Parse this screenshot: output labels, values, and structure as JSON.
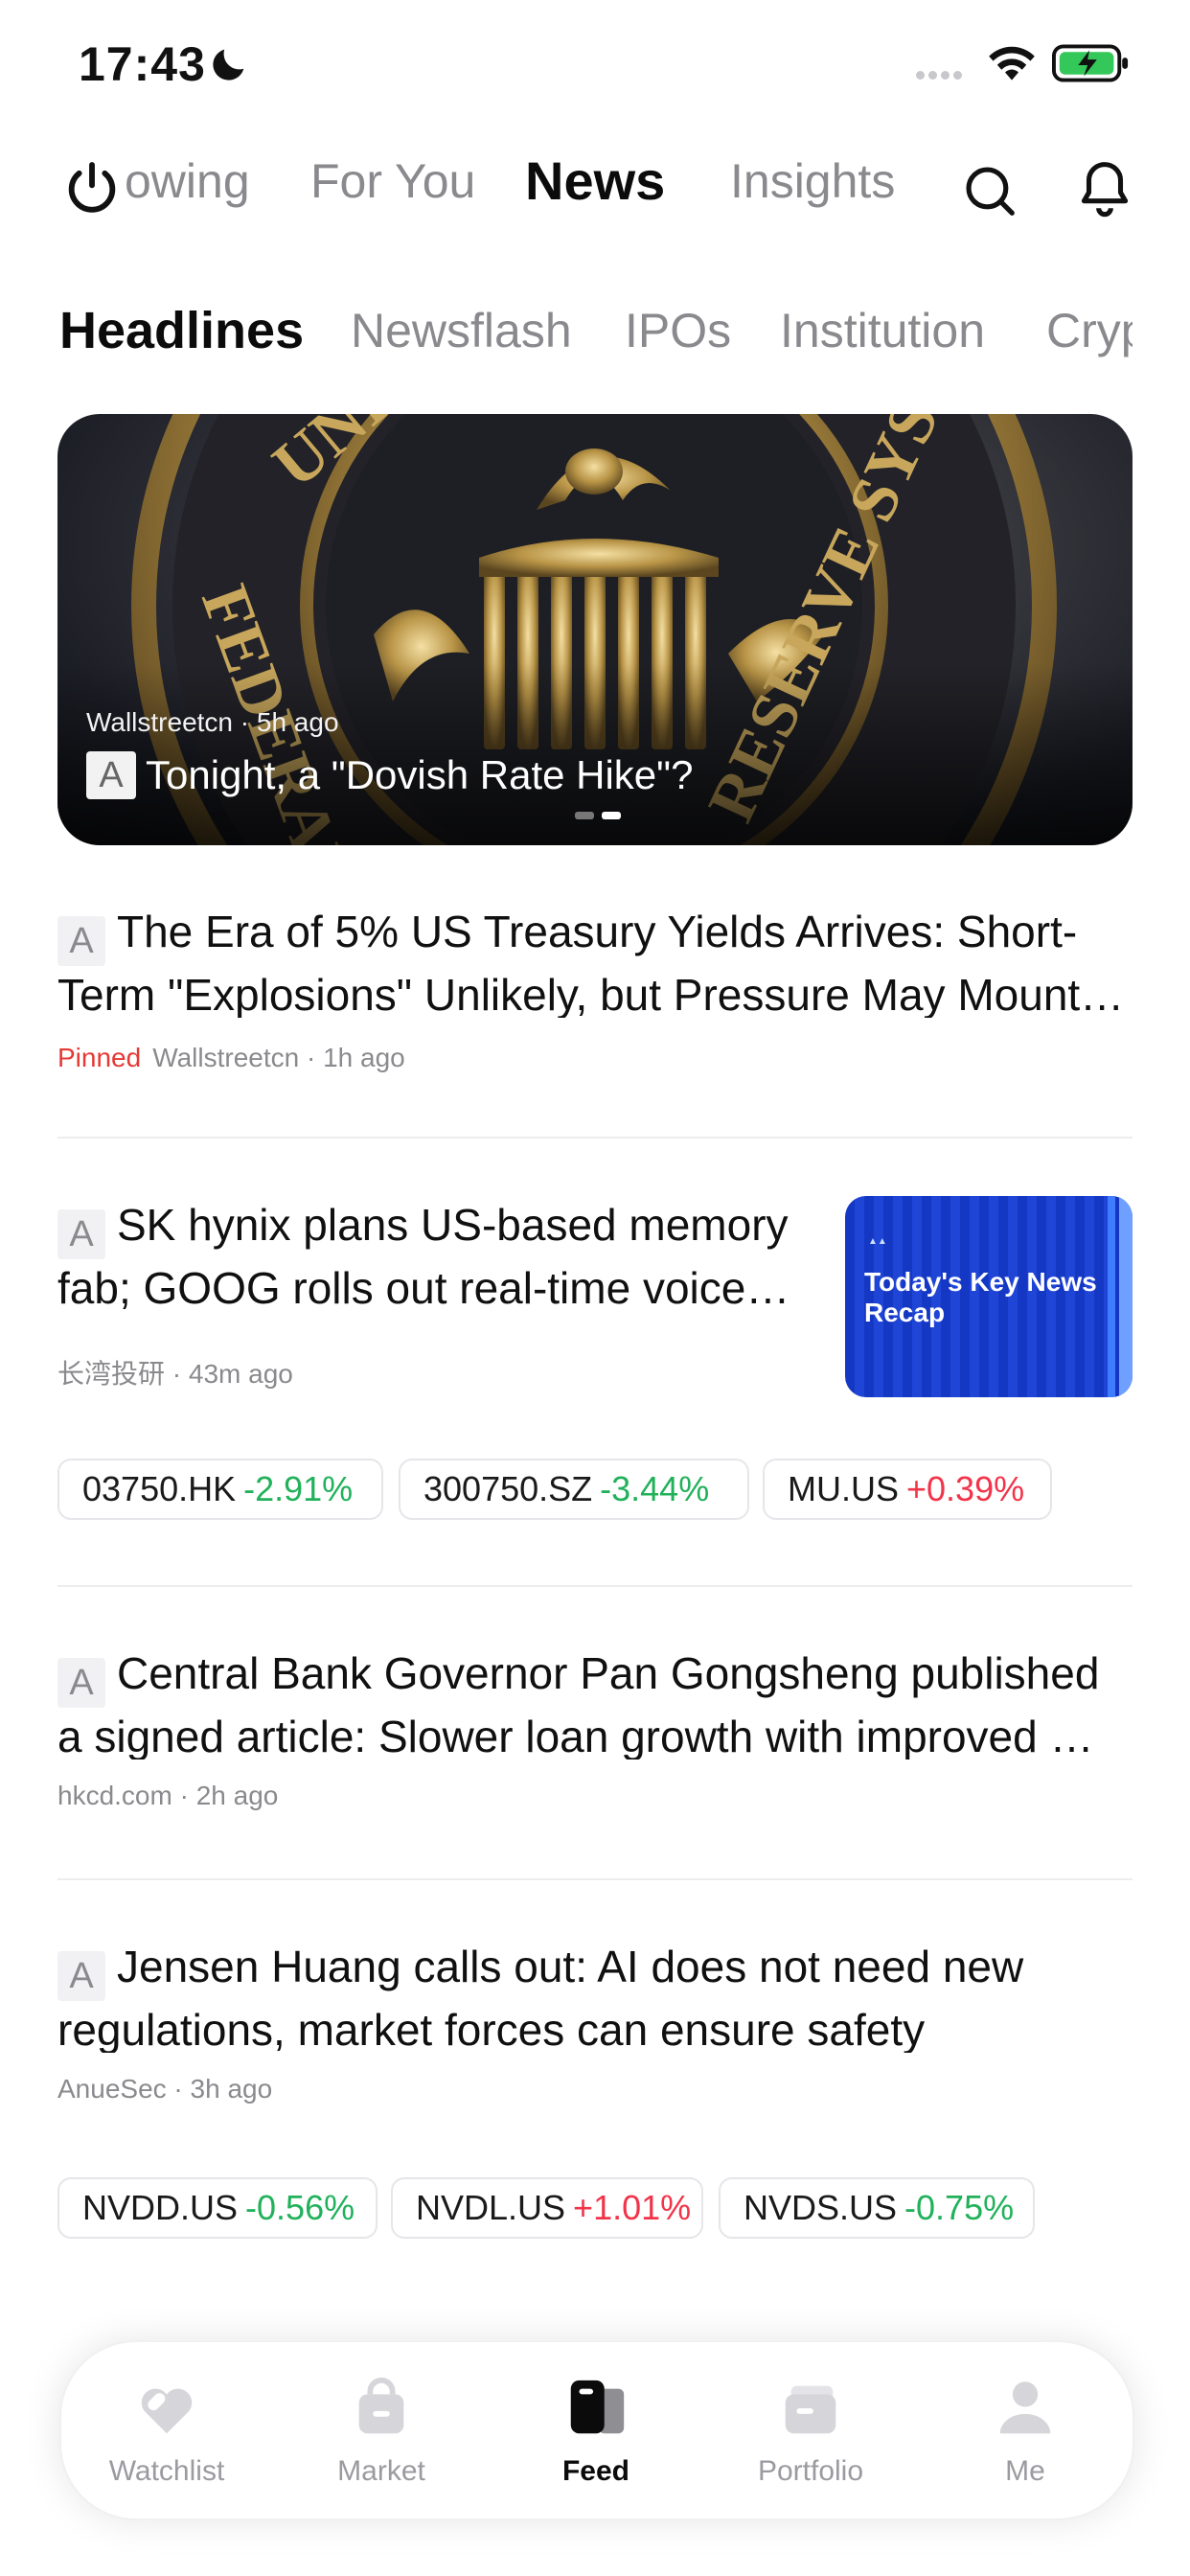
{
  "status_bar": {
    "time": "17:43"
  },
  "top_nav": {
    "items": [
      "owing",
      "For You",
      "News",
      "Insights"
    ],
    "active": "News"
  },
  "sub_tabs": {
    "items": [
      "Headlines",
      "Newsflash",
      "IPOs",
      "Institution",
      "Cryp"
    ],
    "active": "Headlines"
  },
  "hero": {
    "source_time": "Wallstreetcn · 5h ago",
    "badge": "A",
    "title": "Tonight, a \"Dovish Rate Hike\"?",
    "seal_text_top": "UNITED STATES",
    "seal_text_left": "FEDERAL",
    "seal_text_right": "RESERVE SYSTEM"
  },
  "articles": [
    {
      "badge": "A",
      "title": "The Era of 5% US Treasury Yields Arrives: Short-Term \"Explosions\" Unlikely, but Pressure May Mount…",
      "pinned": "Pinned",
      "meta": "Wallstreetcn · 1h ago"
    },
    {
      "badge": "A",
      "title": "SK hynix plans US-based memory fab; GOOG rolls out real-time voice…",
      "meta": "长湾投研 · 43m ago",
      "thumb_title": "Today's Key News Recap",
      "chips": [
        {
          "ticker": "03750.HK",
          "change": "-2.91%"
        },
        {
          "ticker": "300750.SZ",
          "change": "-3.44%"
        },
        {
          "ticker": "MU.US",
          "change": "+0.39%"
        }
      ]
    },
    {
      "badge": "A",
      "title": "Central Bank Governor Pan Gongsheng published a signed article: Slower loan growth with improved …",
      "meta": "hkcd.com · 2h ago"
    },
    {
      "badge": "A",
      "title": "Jensen Huang calls out: AI does not need new regulations, market forces can ensure safety",
      "meta": "AnueSec · 3h ago",
      "chips": [
        {
          "ticker": "NVDD.US",
          "change": "-0.56%"
        },
        {
          "ticker": "NVDL.US",
          "change": "+1.01%"
        },
        {
          "ticker": "NVDS.US",
          "change": "-0.75%"
        }
      ]
    }
  ],
  "tab_bar": {
    "items": [
      "Watchlist",
      "Market",
      "Feed",
      "Portfolio",
      "Me"
    ],
    "active": "Feed"
  },
  "colors": {
    "negative": "#21b15a",
    "positive": "#f2344a",
    "pinned": "#e53935",
    "thumb_blue": "#1538c4"
  }
}
